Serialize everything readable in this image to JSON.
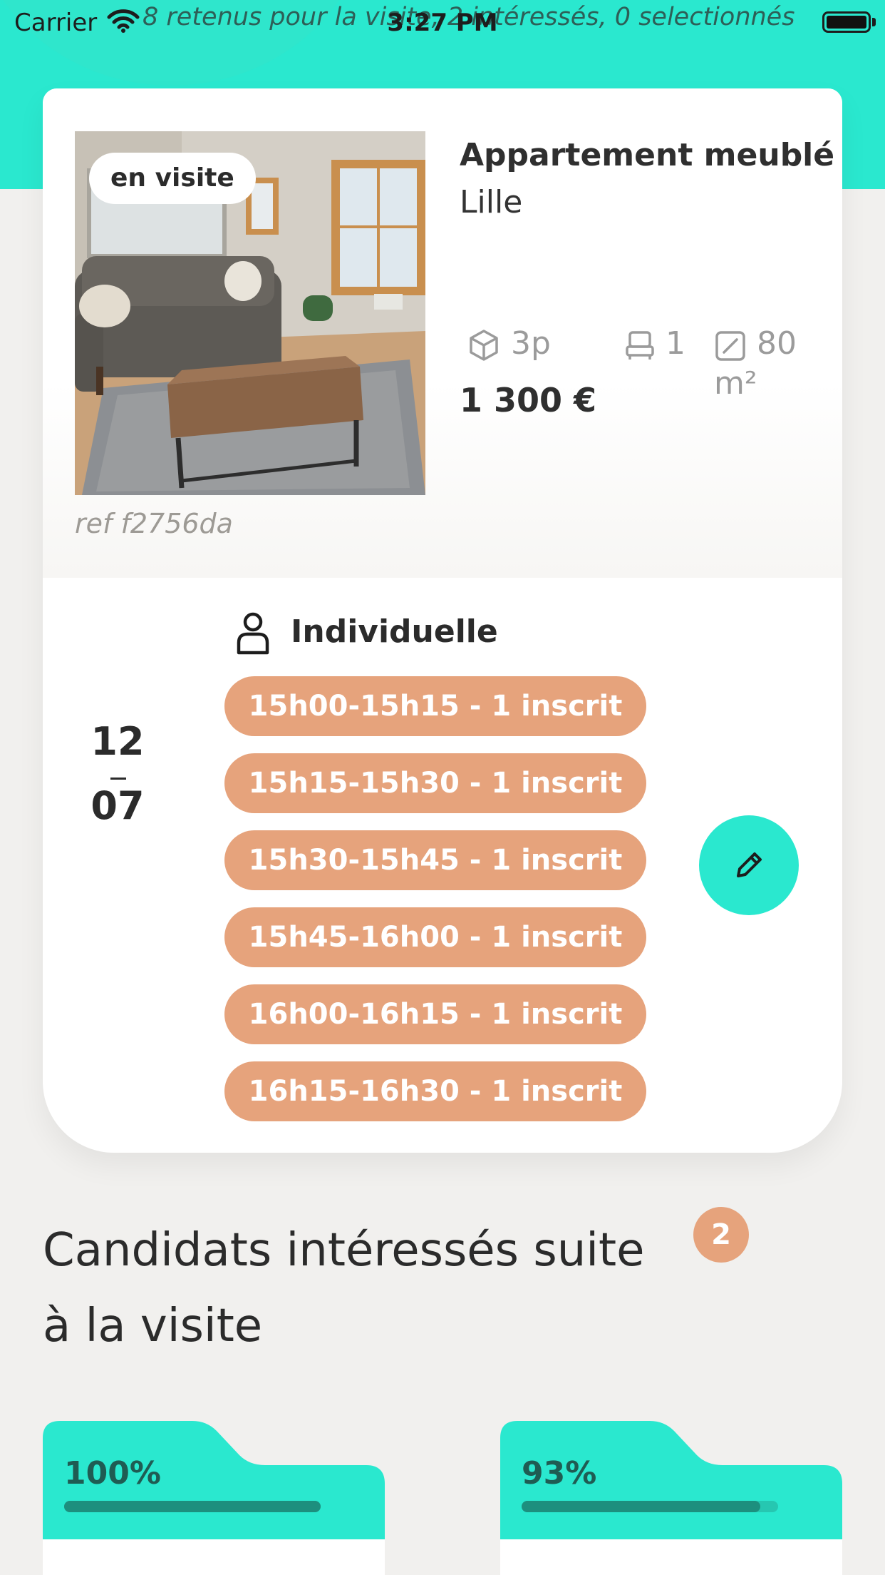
{
  "status_bar": {
    "carrier": "Carrier",
    "time": "3:27 PM",
    "subtitle": "8 retenus pour la visite, 2 intéressés, 0 selectionnés"
  },
  "listing": {
    "badge": "en visite",
    "title": "Appartement meublé",
    "city": "Lille",
    "features": {
      "rooms": "3p",
      "beds": "1",
      "area": "80 m²"
    },
    "price": "1 300 €",
    "ref": "ref f2756da"
  },
  "visit": {
    "day": "12",
    "month": "07",
    "type_label": "Individuelle",
    "slots": [
      "15h00-15h15 - 1 inscrit",
      "15h15-15h30 - 1 inscrit",
      "15h30-15h45 - 1 inscrit",
      "15h45-16h00 - 1 inscrit",
      "16h00-16h15 - 1 inscrit",
      "16h15-16h30 - 1 inscrit"
    ]
  },
  "candidates": {
    "title": "Candidats intéressés suite à la visite",
    "count": "2",
    "cards": [
      {
        "score": "100%",
        "progress": 1.0
      },
      {
        "score": "93%",
        "progress": 0.93
      }
    ]
  },
  "colors": {
    "accent_teal": "#2ae8cf",
    "slot_orange": "#e6a37c",
    "background": "#f1f0ee"
  }
}
